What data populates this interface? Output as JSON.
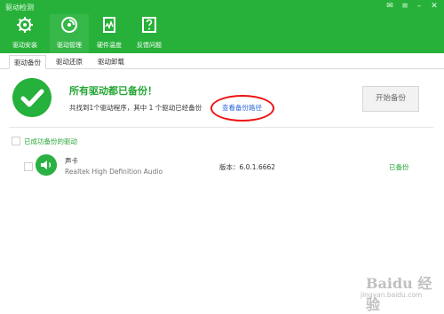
{
  "app": {
    "title": "驱动检测"
  },
  "window": {
    "buttons": [
      {
        "icon": "message-icon"
      },
      {
        "icon": "menu-icon"
      },
      {
        "icon": "minimize-icon"
      },
      {
        "icon": "close-icon"
      }
    ]
  },
  "toolbar": {
    "items": [
      {
        "label": "驱动安装",
        "icon": "gear-icon"
      },
      {
        "label": "驱动管理",
        "icon": "drive-manage-icon"
      },
      {
        "label": "硬件温度",
        "icon": "temperature-icon"
      },
      {
        "label": "反馈问题",
        "icon": "question-icon"
      }
    ]
  },
  "tabs": [
    {
      "label": "驱动备份",
      "active": true
    },
    {
      "label": "驱动还原",
      "active": false
    },
    {
      "label": "驱动卸载",
      "active": false
    }
  ],
  "status": {
    "title": "所有驱动都已备份！",
    "summary": "共找到1个驱动程序，其中 1 个驱动已经备份",
    "link": "查看备份路径",
    "button": "开始备份"
  },
  "section": {
    "label": "已成功备份的驱动"
  },
  "drivers": [
    {
      "name": "声卡",
      "description": "Realtek High Definition Audio",
      "version": "版本：6.0.1.6662",
      "status": "已备份",
      "icon": "speaker-icon"
    }
  ],
  "watermark": {
    "main": "Baidu 经验",
    "sub": "jingyan.baidu.com"
  },
  "colors": {
    "brand": "#27b13a",
    "accent": "#25a634",
    "link": "#2c68d9",
    "highlight": "#e11111"
  }
}
